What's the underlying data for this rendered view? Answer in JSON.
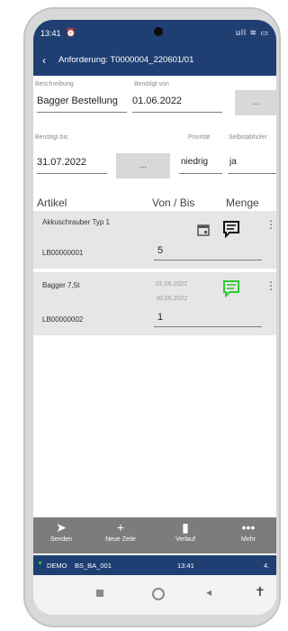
{
  "status": {
    "time": "13:41",
    "system": "ull ≋ ▭"
  },
  "appbar": {
    "title": "Anforderung: T0000004_220601/01"
  },
  "form": {
    "beschreibung_label": "Beschreibung",
    "beschreibung_value": "Bagger Bestellung",
    "benoetigt_von_label": "Benötigt von",
    "benoetigt_von_value": "01.06.2022",
    "benoetigt_bis_label": "Benötigt bis",
    "benoetigt_bis_value": "31.07.2022",
    "prioritaet_label": "Priorität",
    "prioritaet_value": "niedrig",
    "selbstabholer_label": "Selbstabholer",
    "selbstabholer_value": "ja",
    "picker_label": "..."
  },
  "table": {
    "col_artikel": "Artikel",
    "col_von_bis": "Von / Bis",
    "col_menge": "Menge",
    "items": [
      {
        "name": "Akkuschrauber Typ 1",
        "code": "LB00000001",
        "qty": "5",
        "from": "",
        "to": ""
      },
      {
        "name": "Bagger 7,5t",
        "code": "LB00000002",
        "qty": "1",
        "from": "01.06.2022",
        "to": "30.06.2022"
      }
    ]
  },
  "bottombar": {
    "senden": "Senden",
    "neue_zeile": "Neue Zeile",
    "verlauf": "Verlauf",
    "mehr": "Mehr"
  },
  "infobar": {
    "env": "DEMO",
    "user": "BS_BA_001",
    "time": "13:41",
    "extra": "4."
  },
  "colors": {
    "primary": "#1f3f73",
    "accent_green": "#32c832",
    "toolbar_gray": "#7c7c7c"
  }
}
